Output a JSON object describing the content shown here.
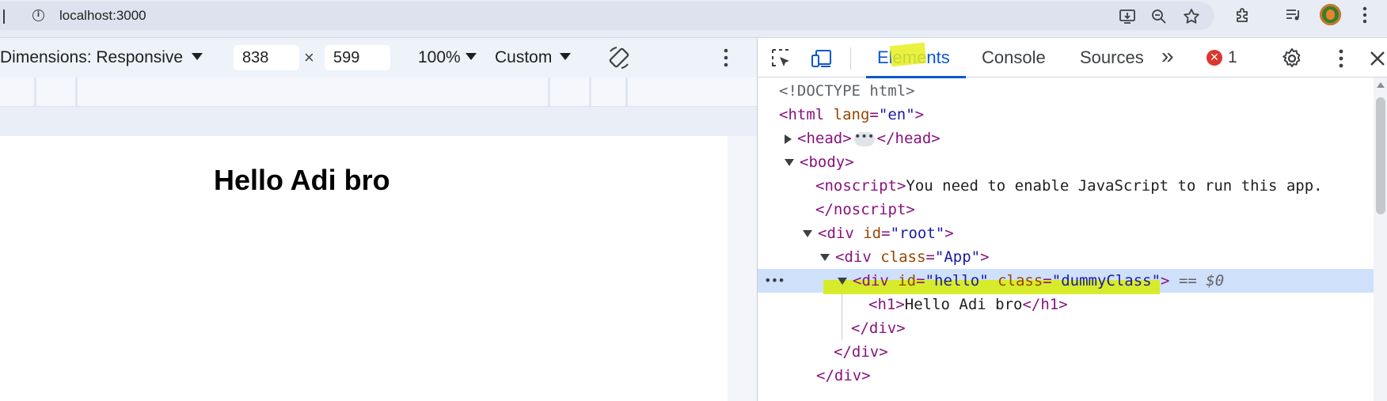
{
  "browser": {
    "url": "localhost:3000"
  },
  "device_toolbar": {
    "dimensions_label": "Dimensions: Responsive",
    "width": "838",
    "times_symbol": "×",
    "height": "599",
    "zoom": "100%",
    "throttle": "Custom"
  },
  "page": {
    "heading": "Hello Adi bro"
  },
  "devtools": {
    "tabs": [
      "Elements",
      "Console",
      "Sources"
    ],
    "overflow": "»",
    "error_count": "1",
    "error_badge": "✕"
  },
  "dom_tree": {
    "doctype": "<!DOCTYPE html>",
    "html_open": "<html",
    "html_attr_name": "lang",
    "html_attr_value": "\"en\"",
    "head_open": "<head>",
    "head_ellipsis": "•••",
    "head_close": "</head>",
    "body_open": "<body>",
    "noscript_open": "<noscript>",
    "noscript_text": "You need to enable JavaScript to run this app.",
    "noscript_close": "</noscript>",
    "div_root_open": "<div",
    "attr_id": "id",
    "root_value": "\"root\"",
    "app_open": "<div",
    "attr_class": "class",
    "app_value": "\"App\"",
    "hello_open": "<div",
    "hello_id_value": "\"hello\"",
    "hello_class_value": "\"dummyClass\"",
    "selected_marker": "== $0",
    "row_menu": "•••",
    "h1_open": "<h1>",
    "h1_text": "Hello Adi bro",
    "h1_close": "</h1>",
    "div_close": "</div>"
  }
}
